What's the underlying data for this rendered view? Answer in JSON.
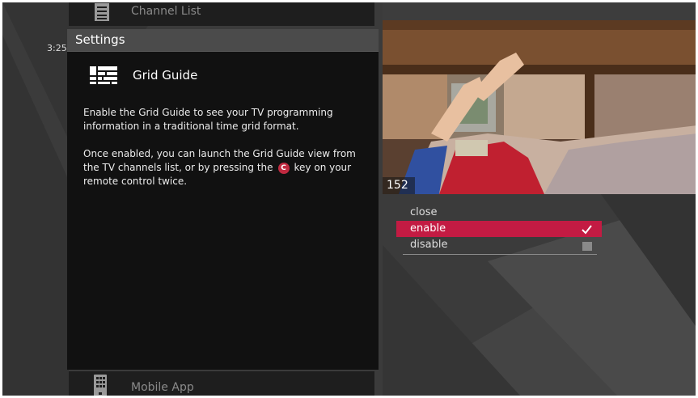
{
  "sidebar": {
    "top_item": {
      "label": "Channel List",
      "icon": "list-icon"
    },
    "bottom_item": {
      "label": "Mobile App",
      "icon": "mobile-phone-icon"
    }
  },
  "clock": "3:25",
  "settings": {
    "title": "Settings",
    "feature": {
      "icon": "grid-guide-icon",
      "title": "Grid Guide"
    },
    "description_1": "Enable the Grid Guide to see your TV programming information in a traditional time grid format.",
    "description_2_before": "Once enabled, you can launch the Grid Guide view from the TV channels list, or by pressing the",
    "key_label": "C",
    "description_2_after": "key on your remote control twice."
  },
  "preview": {
    "channel_number": "152"
  },
  "options": [
    {
      "label": "close",
      "state": "none"
    },
    {
      "label": "enable",
      "state": "checked",
      "selected": true
    },
    {
      "label": "disable",
      "state": "unchecked"
    }
  ],
  "colors": {
    "accent": "#c31b43",
    "panel": "#111111",
    "header": "#4b4b4b"
  }
}
